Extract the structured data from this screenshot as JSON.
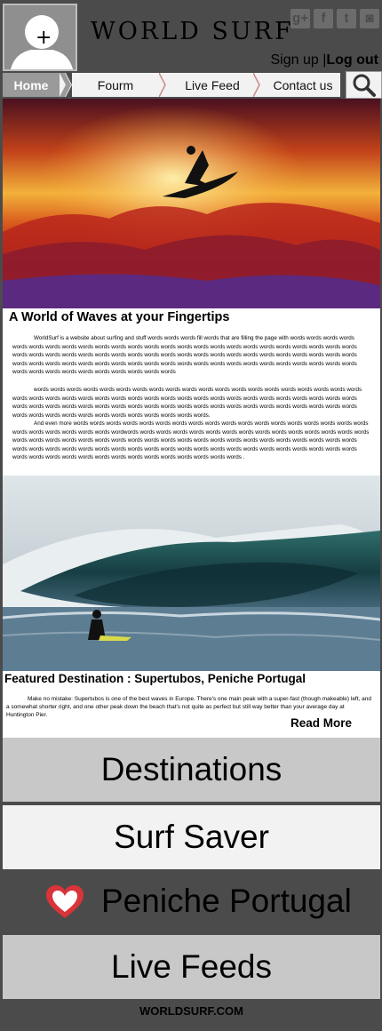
{
  "header": {
    "logo": "WORLD SURF",
    "auth": {
      "signup": "Sign up",
      "separator": "|",
      "logout": "Log out"
    },
    "social": [
      {
        "icon": "google-plus-icon",
        "glyph": "g+"
      },
      {
        "icon": "facebook-icon",
        "glyph": "f"
      },
      {
        "icon": "twitter-icon",
        "glyph": "t"
      },
      {
        "icon": "instagram-icon",
        "glyph": "◙"
      }
    ]
  },
  "nav": {
    "items": [
      {
        "label": "Home",
        "active": true
      },
      {
        "label": "Fourm",
        "active": false
      },
      {
        "label": "Live Feed",
        "active": false
      },
      {
        "label": "Contact us",
        "active": false
      }
    ],
    "search_icon": "search-icon"
  },
  "article": {
    "heading": "A World of Waves at your Fingertips",
    "paragraphs": [
      "WorldSurf is a website about surfing and stuff words words words fill words that are filling the page with words words words words words words words words words words words words words words words words words words words words words words words words words words words words words words words words words words words words words words words words words words words words words words words words words words words words words words words words words words words words words words words words words words words words words words words words words words words words words",
      "words words words words words words words words words words words words words words words words words words words words words words words words words words words words words words words words words words words words words words words words words words words words words words words words words words words words words words words words words words words words words words words words words words words words words words words words words words.",
      "And even more words words words words words words words words words words words words words words words words words words words words words words words words wordwords words words words words words words words words words words words words words words words words words words words words words words words words words words words words words words words words words words words words words words words words words words words words words words words words words words words words words words words words words words words words words words words words words words words words words words ."
    ]
  },
  "featured": {
    "heading": "Featured Destination : Supertubos, Peniche Portugal",
    "body": "Make no mistake: Supertubos is one of the best waves in Europe. There's one main peak with a super-fast (though makeable) left, and a somewhat shorter right, and one other peak down the beach that's not quite as perfect but still way better than your average day at Huntington Pier.",
    "read_more": "Read More"
  },
  "menu": {
    "destinations": "Destinations",
    "surf_saver": "Surf Saver",
    "peniche": "Peniche Portugal",
    "live_feeds": "Live Feeds"
  },
  "footer": {
    "site": "WORLDSURF.COM"
  },
  "colors": {
    "frame": "#4b4b4b",
    "nav_bg": "#f2f2f2",
    "active_tab": "#9a9a9a",
    "menu_light": "#c8c8c8",
    "heart": "#d8343a"
  }
}
